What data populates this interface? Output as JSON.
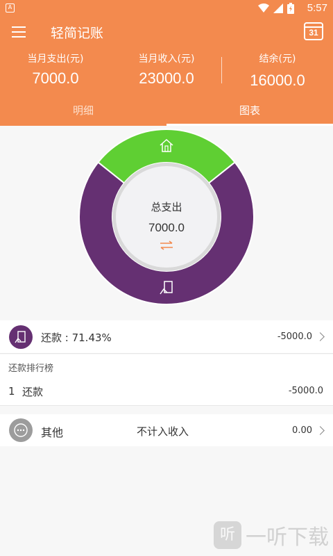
{
  "status_bar": {
    "notif_icon": "A",
    "time": "5:57"
  },
  "header": {
    "title": "轻简记账",
    "calendar_day": "31",
    "stats": [
      {
        "label": "当月支出(元)",
        "value": "7000.0"
      },
      {
        "label": "当月收入(元)",
        "value": "23000.0"
      },
      {
        "label": "结余(元)",
        "value": "16000.0"
      }
    ],
    "tabs": [
      {
        "label": "明细",
        "active": false
      },
      {
        "label": "图表",
        "active": true
      }
    ]
  },
  "chart_data": {
    "type": "pie",
    "categories": [
      "还款",
      "其他"
    ],
    "values": [
      5000.0,
      2000.0
    ],
    "colors": [
      "#653072",
      "#5fcf33"
    ],
    "center_title": "总支出",
    "center_value": "7000.0",
    "swap_icon": "swap-arrows-icon"
  },
  "category_row": {
    "label": "还款 : 71.43%",
    "amount": "-5000.0",
    "color": "#653072",
    "icon": "repayment-icon"
  },
  "ranking": {
    "title": "还款排行榜",
    "items": [
      {
        "rank": "1",
        "name": "还款",
        "amount": "-5000.0"
      }
    ]
  },
  "other_row": {
    "label": "其他",
    "note": "不计入收入",
    "amount": "0.00",
    "icon": "more-dots-icon"
  },
  "watermark": {
    "icon_char": "听",
    "text": "一听下载"
  }
}
